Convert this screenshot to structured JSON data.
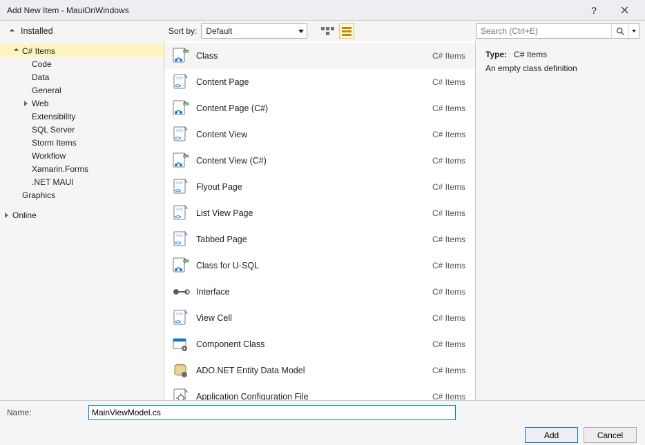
{
  "window": {
    "title": "Add New Item - MauiOnWindows"
  },
  "topbar": {
    "installed_label": "Installed",
    "sort_label": "Sort by:",
    "sort_value": "Default",
    "search_placeholder": "Search (Ctrl+E)"
  },
  "tree": {
    "root_csharp": "C# Items",
    "items": [
      "Code",
      "Data",
      "General",
      "Web",
      "Extensibility",
      "SQL Server",
      "Storm Items",
      "Workflow",
      "Xamarin.Forms",
      ".NET MAUI"
    ],
    "graphics": "Graphics",
    "online": "Online"
  },
  "templates": [
    {
      "name": "Class",
      "category": "C# Items",
      "icon": "cs-class",
      "selected": true
    },
    {
      "name": "Content Page",
      "category": "C# Items",
      "icon": "xaml-page"
    },
    {
      "name": "Content Page (C#)",
      "category": "C# Items",
      "icon": "cs-class"
    },
    {
      "name": "Content View",
      "category": "C# Items",
      "icon": "xaml-page"
    },
    {
      "name": "Content View (C#)",
      "category": "C# Items",
      "icon": "cs-class"
    },
    {
      "name": "Flyout Page",
      "category": "C# Items",
      "icon": "xaml-page"
    },
    {
      "name": "List View Page",
      "category": "C# Items",
      "icon": "xaml-page"
    },
    {
      "name": "Tabbed Page",
      "category": "C# Items",
      "icon": "xaml-page"
    },
    {
      "name": "Class for U-SQL",
      "category": "C# Items",
      "icon": "cs-class"
    },
    {
      "name": "Interface",
      "category": "C# Items",
      "icon": "interface"
    },
    {
      "name": "View Cell",
      "category": "C# Items",
      "icon": "xaml-page"
    },
    {
      "name": "Component Class",
      "category": "C# Items",
      "icon": "component"
    },
    {
      "name": "ADO.NET Entity Data Model",
      "category": "C# Items",
      "icon": "entity"
    },
    {
      "name": "Application Configuration File",
      "category": "C# Items",
      "icon": "config"
    }
  ],
  "details": {
    "type_label": "Type:",
    "type_value": "C# Items",
    "description": "An empty class definition"
  },
  "bottom": {
    "name_label": "Name:",
    "name_value": "MainViewModel.cs",
    "add_label": "Add",
    "cancel_label": "Cancel"
  }
}
